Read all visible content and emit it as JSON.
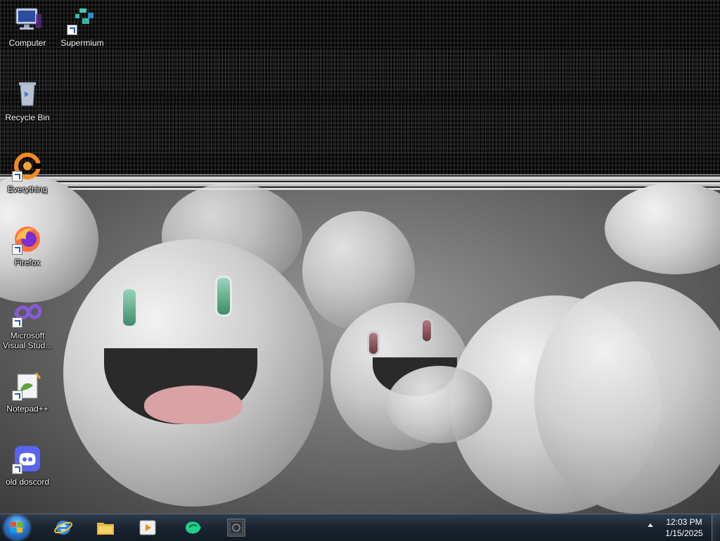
{
  "desktop": {
    "icons": [
      {
        "label": "Computer",
        "icon": "computer-icon",
        "shortcut": false
      },
      {
        "label": "Supermium",
        "icon": "supermium-icon",
        "shortcut": true
      },
      {
        "label": "Recycle Bin",
        "icon": "recycle-bin-icon",
        "shortcut": false
      },
      {
        "label": "Everything",
        "icon": "everything-icon",
        "shortcut": true
      },
      {
        "label": "Firefox",
        "icon": "firefox-icon",
        "shortcut": true
      },
      {
        "label": "Microsoft Visual Stud...",
        "icon": "visual-studio-icon",
        "shortcut": true
      },
      {
        "label": "Notepad++",
        "icon": "notepad-plus-plus-icon",
        "shortcut": true
      },
      {
        "label": "old doscord",
        "icon": "discord-icon",
        "shortcut": true
      }
    ]
  },
  "taskbar": {
    "pinned": [
      {
        "name": "internet-explorer",
        "icon": "internet-explorer-icon"
      },
      {
        "name": "file-explorer",
        "icon": "folder-icon"
      },
      {
        "name": "media-player",
        "icon": "media-player-icon"
      },
      {
        "name": "app-green-arrow",
        "icon": "green-arrow-icon"
      },
      {
        "name": "app-dark-square",
        "icon": "dark-square-app-icon"
      }
    ],
    "clock": {
      "time": "12:03 PM",
      "date": "1/15/2025"
    }
  },
  "colors": {
    "taskbar": "#1a2431",
    "start_orb": "#2b7bd3",
    "firefox": "#ff7139",
    "discord": "#5865f2"
  }
}
